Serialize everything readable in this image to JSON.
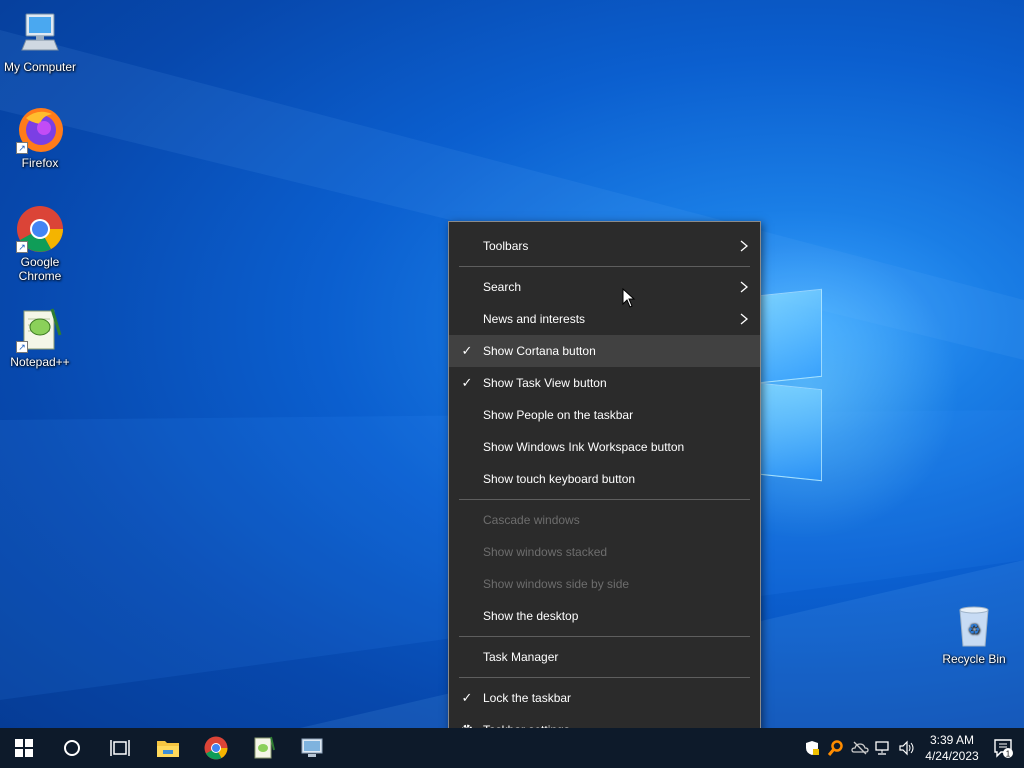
{
  "desktop": {
    "icons": [
      {
        "label": "My Computer"
      },
      {
        "label": "Firefox"
      },
      {
        "label": "Google Chrome"
      },
      {
        "label": "Notepad++"
      },
      {
        "label": "Recycle Bin"
      }
    ]
  },
  "context_menu": {
    "items": [
      {
        "label": "Toolbars",
        "submenu": true
      },
      {
        "label": "Search",
        "submenu": true
      },
      {
        "label": "News and interests",
        "submenu": true
      },
      {
        "label": "Show Cortana button",
        "checked": true,
        "highlighted": true
      },
      {
        "label": "Show Task View button",
        "checked": true
      },
      {
        "label": "Show People on the taskbar"
      },
      {
        "label": "Show Windows Ink Workspace button"
      },
      {
        "label": "Show touch keyboard button"
      },
      {
        "label": "Cascade windows",
        "disabled": true
      },
      {
        "label": "Show windows stacked",
        "disabled": true
      },
      {
        "label": "Show windows side by side",
        "disabled": true
      },
      {
        "label": "Show the desktop"
      },
      {
        "label": "Task Manager"
      },
      {
        "label": "Lock the taskbar",
        "checked": true
      },
      {
        "label": "Taskbar settings",
        "icon": "gear-icon"
      }
    ],
    "check_glyph": "✓"
  },
  "taskbar": {
    "buttons": [
      "start-icon",
      "cortana-icon",
      "task-view-icon",
      "file-explorer-icon",
      "chrome-icon",
      "notepadpp-icon",
      "remote-desktop-icon"
    ],
    "tray": {
      "time": "3:39 AM",
      "date": "4/24/2023",
      "notification_count": "1"
    }
  },
  "colors": {
    "menu_bg": "#2b2b2b",
    "menu_highlight": "#414141",
    "menu_disabled_text": "#6d6d6d",
    "taskbar_bg": "#0d1a2a",
    "desktop_blue": "#0b5fcf"
  }
}
